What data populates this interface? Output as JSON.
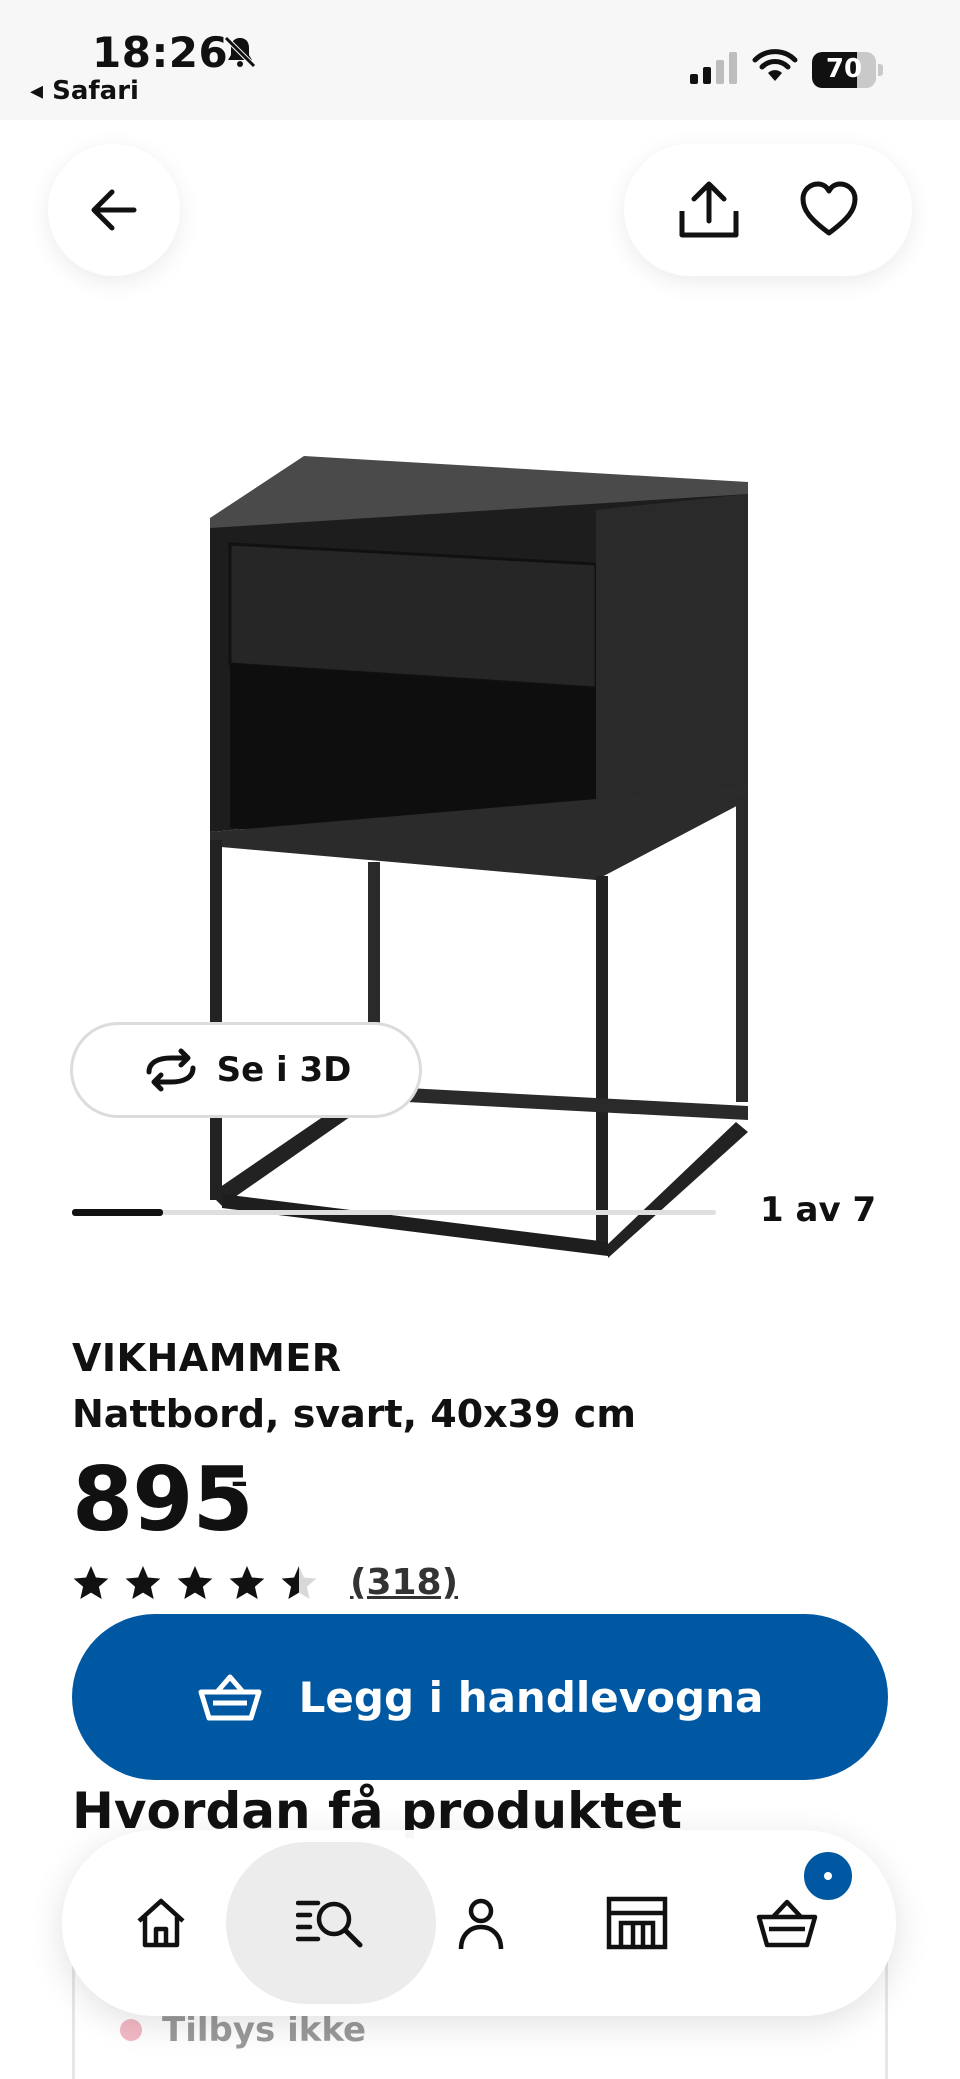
{
  "status_bar": {
    "time": "18:26",
    "back_app": "◂ Safari",
    "battery_percent": "70",
    "battery_level": 0.7
  },
  "gallery": {
    "see_3d": "Se i 3D",
    "counter": "1 av 7",
    "progress": 0.142
  },
  "product": {
    "name": "VIKHAMMER",
    "description": "Nattbord, svart, 40x39 cm",
    "price": "895",
    "price_suffix": ",–",
    "rating": 4.5,
    "reviews": "(318)"
  },
  "buttons": {
    "add_to_cart": "Legg i handlevogna"
  },
  "section": {
    "title": "Hvordan få produktet"
  },
  "availability": {
    "status": "Tilbys ikke"
  },
  "colors": {
    "brand_blue": "#0058a3",
    "product_black": "#1b1b1b"
  },
  "tabbar": {
    "icons": [
      "home-icon",
      "search-icon",
      "account-icon",
      "store-icon",
      "cart-icon"
    ],
    "active": "search"
  }
}
